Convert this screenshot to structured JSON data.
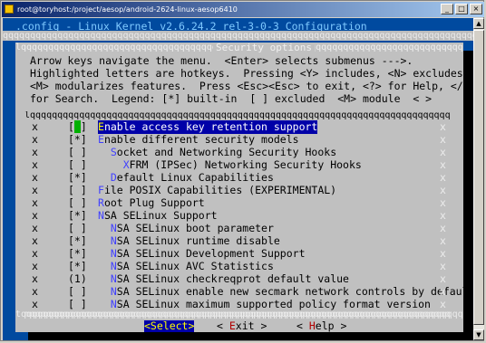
{
  "window": {
    "title": "root@toryhost:/project/aesop/android-2624-linux-aesop6410",
    "buttons": [
      "_",
      "□",
      "×"
    ]
  },
  "terminal": {
    "header": ".config - Linux Kernel v2.6.24.2 rel-3-0-3 Configuration",
    "rule_fill": "qqqqqqqqqqqqqqqqqqqqqqqqqqqqqqqqqqqqqqqqqqqqqqqqqqqqqqqqqqqqqqqqqqqqqqqqqqqqqqqqqqqqqqqqqqqqqqq"
  },
  "dialog": {
    "title": "Security options",
    "title_fill": "lqqqqqqqqqqqqqqqqqqqqqqqqqqqqqqqqqqqqqqqqqqqqqqqqqqqqqqqqqqqqqqqqqqqqqqqqqqqqqqqqqqk",
    "help": [
      "Arrow keys navigate the menu.  <Enter> selects submenus --->.",
      "Highlighted letters are hotkeys.  Pressing <Y> includes, <N> excludes,",
      "<M> modularizes features.  Press <Esc><Esc> to exit, <?> for Help, </>",
      "for Search.  Legend: [*] built-in  [ ] excluded  <M> module  < >"
    ],
    "list_top": "lqqqqqqqqqqqqqqqqqqqqqqqqqqqqqqqqqqqqqqqqqqqqqqqqqqqqqqqqqqqqqqqqqqqqqqqqqqqqqqk",
    "list_bottom": "mqqqqqqqqqqqqqqqqqqqqqqqqqqqqqqqqqqqqqqqqqqqqqqqqqqqqqqqqqqqqqqqqqqqqqqqqqqqqqqj",
    "divider": "tqqqqqqqqqqqqqqqqqqqqqqqqqqqqqqqqqqqqqqqqqqqqqqqqqqqqqqqqqqqqqqqqqqqqqqqqqqqqqqqqqqqqu",
    "bottom_border": "mqqqqqqqqqqqqqqqqqqqqqqqqqqqqqqqqqqqqqqqqqqqqqqqqqqqqqqqqqqqqqqqqqqqqqqqqqqqqqqqqqqqqj",
    "edge": "x",
    "items": [
      {
        "mark": "[ ]",
        "pre": "",
        "hot": "E",
        "rest": "nable access key retention support",
        "selected": true
      },
      {
        "mark": "[*]",
        "pre": "",
        "hot": "E",
        "rest": "nable different security models",
        "selected": false
      },
      {
        "mark": "[ ]",
        "pre": "  ",
        "hot": "S",
        "rest": "ocket and Networking Security Hooks",
        "selected": false
      },
      {
        "mark": "[ ]",
        "pre": "    ",
        "hot": "X",
        "rest": "FRM (IPSec) Networking Security Hooks",
        "selected": false
      },
      {
        "mark": "[*]",
        "pre": "  ",
        "hot": "D",
        "rest": "efault Linux Capabilities",
        "selected": false
      },
      {
        "mark": "[ ]",
        "pre": "",
        "hot": "F",
        "rest": "ile POSIX Capabilities (EXPERIMENTAL)",
        "selected": false
      },
      {
        "mark": "[ ]",
        "pre": "",
        "hot": "R",
        "rest": "oot Plug Support",
        "selected": false
      },
      {
        "mark": "[*]",
        "pre": "",
        "hot": "N",
        "rest": "SA SELinux Support",
        "selected": false
      },
      {
        "mark": "[ ]",
        "pre": "  ",
        "hot": "N",
        "rest": "SA SELinux boot parameter",
        "selected": false
      },
      {
        "mark": "[*]",
        "pre": "  ",
        "hot": "N",
        "rest": "SA SELinux runtime disable",
        "selected": false
      },
      {
        "mark": "[*]",
        "pre": "  ",
        "hot": "N",
        "rest": "SA SELinux Development Support",
        "selected": false
      },
      {
        "mark": "[*]",
        "pre": "  ",
        "hot": "N",
        "rest": "SA SELinux AVC Statistics",
        "selected": false
      },
      {
        "mark": "(1)",
        "pre": "  ",
        "hot": "N",
        "rest": "SA SELinux checkreqprot default value",
        "selected": false
      },
      {
        "mark": "[ ]",
        "pre": "  ",
        "hot": "N",
        "rest": "SA SELinux enable new secmark network controls by default",
        "selected": false
      },
      {
        "mark": "[ ]",
        "pre": "  ",
        "hot": "N",
        "rest": "SA SELinux maximum supported policy format version",
        "selected": false
      }
    ],
    "buttons": [
      {
        "label": "<Select>",
        "active": true
      },
      {
        "pre": "< ",
        "hot": "E",
        "rest": "xit >",
        "active": false
      },
      {
        "pre": "< ",
        "hot": "H",
        "rest": "elp >",
        "active": false
      }
    ]
  },
  "colors": {
    "terminal_bg": "#004a9f",
    "dialog_bg": "#c0c0c0",
    "selection_bg": "#0000a8",
    "hotkey": "#4040ff"
  }
}
